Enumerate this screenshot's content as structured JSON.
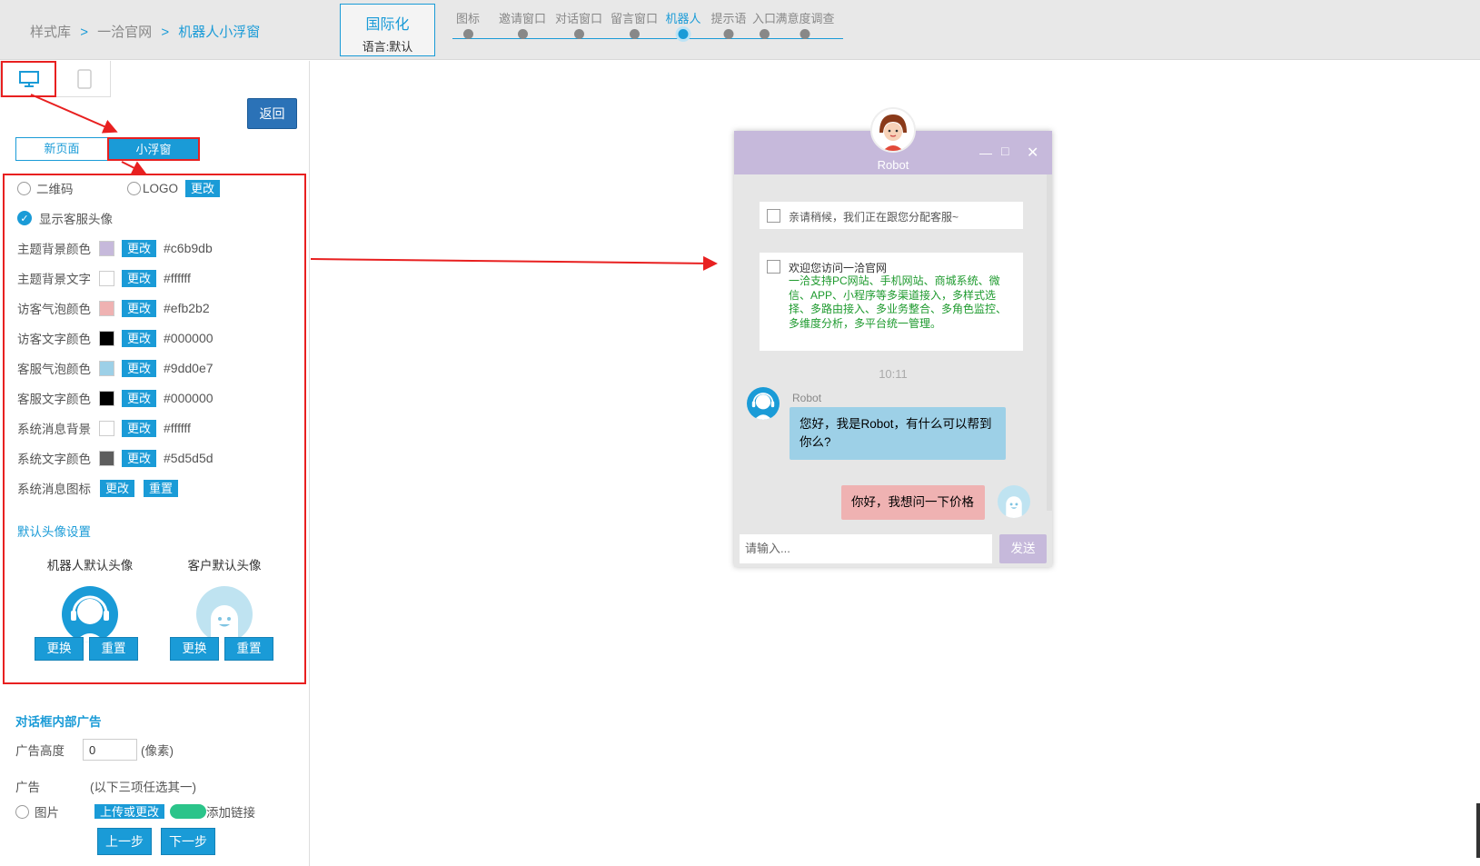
{
  "breadcrumb": {
    "item1": "样式库",
    "item2": "一洽官网",
    "item3": "机器人小浮窗",
    "sep": ">"
  },
  "intl": {
    "title": "国际化",
    "lang": "语言:默认"
  },
  "steps": [
    {
      "label": "图标"
    },
    {
      "label": "邀请窗口"
    },
    {
      "label": "对话窗口"
    },
    {
      "label": "留言窗口"
    },
    {
      "label": "机器人"
    },
    {
      "label": "提示语"
    },
    {
      "label": "入口"
    },
    {
      "label": "满意度调查"
    }
  ],
  "active_step": "机器人",
  "left": {
    "back": "返回",
    "mode_new": "新页面",
    "mode_float": "小浮窗",
    "qr_label": "二维码",
    "logo_label": "LOGO",
    "change": "更改",
    "show_avatar": "显示客服头像",
    "colors": [
      {
        "label": "主题背景颜色",
        "hex": "#c6b9db"
      },
      {
        "label": "主题背景文字",
        "hex": "#ffffff"
      },
      {
        "label": "访客气泡颜色",
        "hex": "#efb2b2"
      },
      {
        "label": "访客文字颜色",
        "hex": "#000000"
      },
      {
        "label": "客服气泡颜色",
        "hex": "#9dd0e7"
      },
      {
        "label": "客服文字颜色",
        "hex": "#000000"
      },
      {
        "label": "系统消息背景",
        "hex": "#ffffff"
      },
      {
        "label": "系统文字颜色",
        "hex": "#5d5d5d"
      }
    ],
    "sys_icon_label": "系统消息图标",
    "reset": "重置",
    "avatar_section": "默认头像设置",
    "robot_avatar": "机器人默认头像",
    "client_avatar": "客户默认头像",
    "replace": "更换",
    "ad_section": "对话框内部广告",
    "ad_height_label": "广告高度",
    "ad_height_value": "0",
    "ad_height_unit": "(像素)",
    "ad_label": "广告",
    "ad_hint": "(以下三项任选其一)",
    "ad_image": "图片",
    "upload": "上传或更改",
    "add_link": "添加链接",
    "prev": "上一步",
    "next": "下一步"
  },
  "chat": {
    "title": "Robot",
    "sys1": "亲请稍候，我们正在跟您分配客服~",
    "sys2_title": "欢迎您访问一洽官网",
    "sys2_body": "一洽支持PC网站、手机网站、商城系统、微信、APP、小程序等多渠道接入，多样式选择、多路由接入、多业务整合、多角色监控、多维度分析，多平台统一管理。",
    "time": "10:11",
    "robot_name": "Robot",
    "robot_msg": "您好，我是Robot，有什么可以帮到你么?",
    "visitor_msg": "你好，我想问一下价格",
    "input_placeholder": "请输入...",
    "send": "发送"
  },
  "colors": {
    "accent": "#1a9bd7",
    "theme": "#c6b9db",
    "visitor_bubble": "#efb2b2",
    "agent_bubble": "#9dd0e7",
    "annotation_red": "#e82020"
  }
}
